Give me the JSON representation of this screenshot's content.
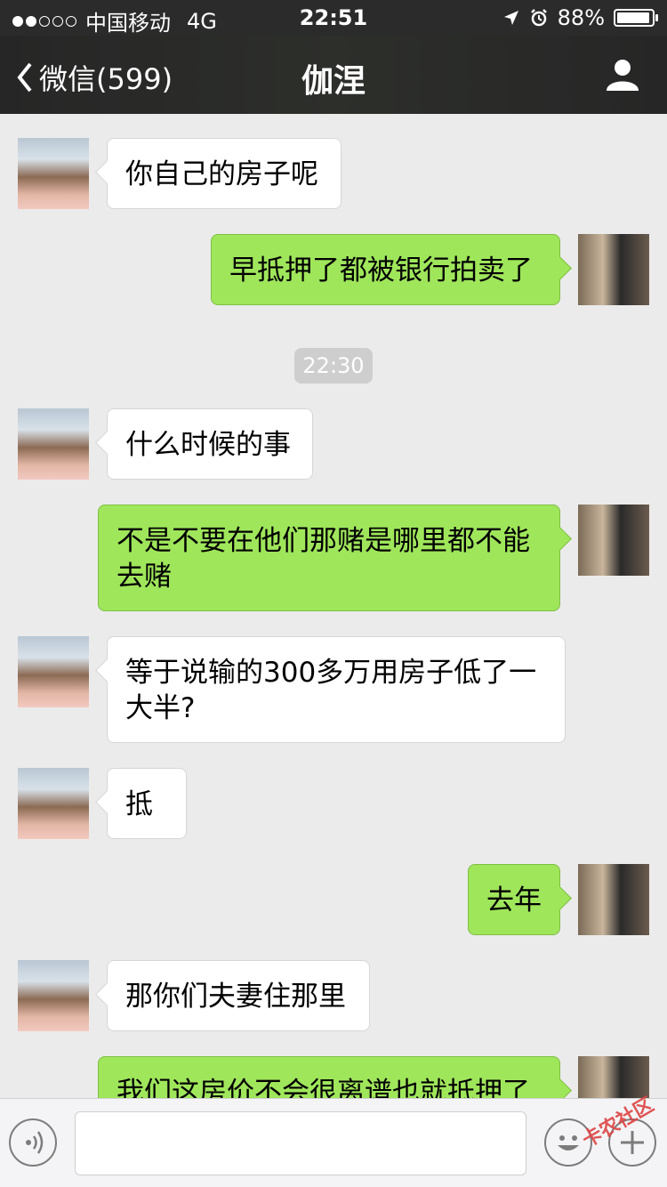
{
  "status_bar": {
    "carrier": "中国移动",
    "network": "4G",
    "time": "22:51",
    "battery": "88%"
  },
  "nav": {
    "back_label": "微信(599)",
    "title": "伽涅"
  },
  "chat": {
    "timestamp": "22:30",
    "messages": [
      {
        "side": "in",
        "text": "你自己的房子呢"
      },
      {
        "side": "out",
        "text": "早抵押了都被银行拍卖了"
      },
      {
        "side": "in",
        "text": "什么时候的事"
      },
      {
        "side": "out",
        "text": "不是不要在他们那赌是哪里都不能去赌"
      },
      {
        "side": "in",
        "text": "等于说输的300多万用房子低了一大半?"
      },
      {
        "side": "in",
        "text": "抵"
      },
      {
        "side": "out",
        "text": "去年"
      },
      {
        "side": "in",
        "text": "那你们夫妻住那里"
      },
      {
        "side": "out",
        "text": "我们这房价不会很离谱也就抵押了"
      }
    ]
  },
  "input_bar": {
    "placeholder": ""
  },
  "watermark": "卡农社区",
  "colors": {
    "outgoing_bubble": "#9fe65b",
    "incoming_bubble": "#ffffff",
    "chat_background": "#ebebeb",
    "navbar": "#2b2b2b"
  }
}
